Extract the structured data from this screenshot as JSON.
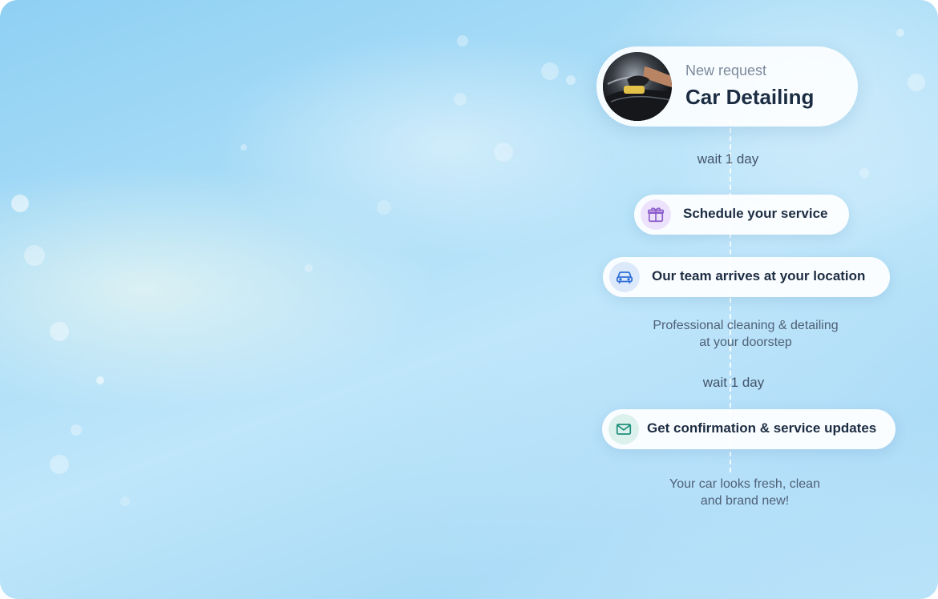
{
  "request": {
    "subtitle": "New request",
    "title": "Car Detailing",
    "avatar_icon": "car-detailing-photo"
  },
  "timeline": {
    "wait_1": "wait 1 day",
    "step_schedule": {
      "label": "Schedule your service",
      "icon": "gift-icon",
      "icon_bg": "#ece2fb",
      "icon_color": "#8b5cc9"
    },
    "step_arrive": {
      "label": "Our team arrives at your location",
      "icon": "car-icon",
      "icon_bg": "#dbe9fb",
      "icon_color": "#2f6fd6"
    },
    "caption_arrive_line1": "Professional cleaning & detailing",
    "caption_arrive_line2": "at your doorstep",
    "wait_2": "wait 1 day",
    "step_confirm": {
      "label": "Get confirmation & service updates",
      "icon": "mail-icon",
      "icon_bg": "#dcf1ec",
      "icon_color": "#1f8f7a"
    },
    "caption_final_line1": "Your car looks fresh, clean",
    "caption_final_line2": "and brand new!"
  }
}
